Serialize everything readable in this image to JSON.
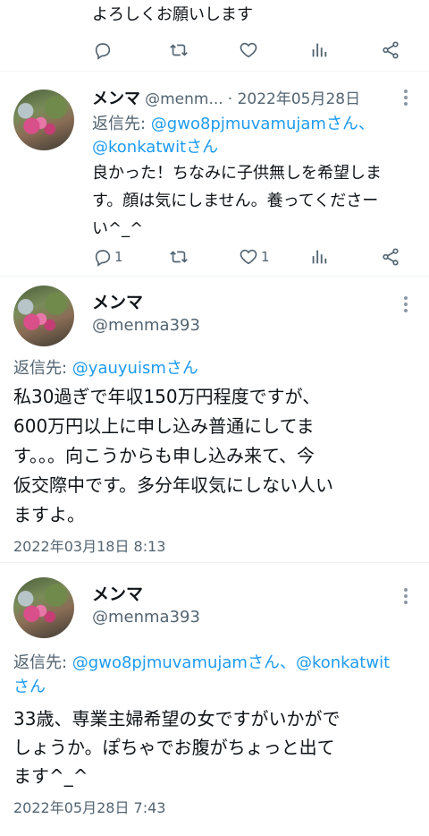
{
  "top_tweet": {
    "text": "よろしくお願いします",
    "actions": {
      "reply_count": "",
      "retweet_count": "",
      "like_count": ""
    }
  },
  "reply1": {
    "name": "メンマ",
    "handle": "@menm...",
    "sep_date": "· 2022年05月28日",
    "reply_prefix": "返信先: ",
    "reply_to_1": "@gwo8pjmuvamujamさん、",
    "reply_to_2": "@konkatwitさん",
    "text_line1": "良かった！ちなみに子供無しを希望しま",
    "text_line2": "す。顔は気にしません。養ってくださー",
    "text_line3": "い^_^",
    "reply_count": "1",
    "retweet_count": "",
    "like_count": "1"
  },
  "tweet2": {
    "name": "メンマ",
    "handle": "@menma393",
    "reply_prefix": "返信先: ",
    "reply_to": "@yauyuismさん",
    "text_line1": "私30過ぎで年収150万円程度ですが、",
    "text_line2": "600万円以上に申し込み普通にしてま",
    "text_line3": "す。。。向こうからも申し込み来て、今",
    "text_line4": "仮交際中です。多分年収気にしない人い",
    "text_line5": "ますよ。",
    "timestamp": "2022年03月18日 8:13"
  },
  "tweet3": {
    "name": "メンマ",
    "handle": "@menma393",
    "reply_prefix": "返信先: ",
    "reply_to_1": "@gwo8pjmuvamujamさん、",
    "reply_to_2": "@konkatwit",
    "reply_to_3": "さん",
    "text_line1": "33歳、専業主婦希望の女ですがいかがで",
    "text_line2": "しょうか。ぽちゃでお腹がちょっと出て",
    "text_line3": "ます^_^",
    "timestamp": "2022年05月28日 7:43"
  },
  "colors": {
    "link": "#1d9bf0",
    "muted": "#536471",
    "text": "#0f1419",
    "divider": "#eff3f4"
  },
  "icons": [
    "reply-icon",
    "retweet-icon",
    "like-icon",
    "analytics-icon",
    "share-icon",
    "more-icon"
  ]
}
